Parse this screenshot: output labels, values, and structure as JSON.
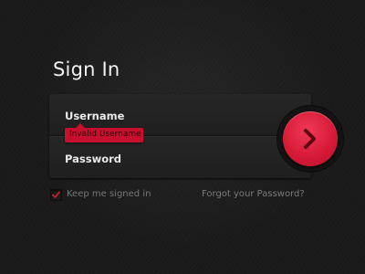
{
  "title": "Sign In",
  "form": {
    "username_label": "Username",
    "username_error": "Invalid Username",
    "password_label": "Password"
  },
  "remember": {
    "label": "Keep me signed in",
    "checked": true
  },
  "forgot_link": "Forgot your Password?",
  "submit": {
    "icon": "chevron-right-icon"
  },
  "colors": {
    "accent": "#d81a38",
    "background": "#1a1a1a",
    "error_bg": "#c8102e"
  }
}
